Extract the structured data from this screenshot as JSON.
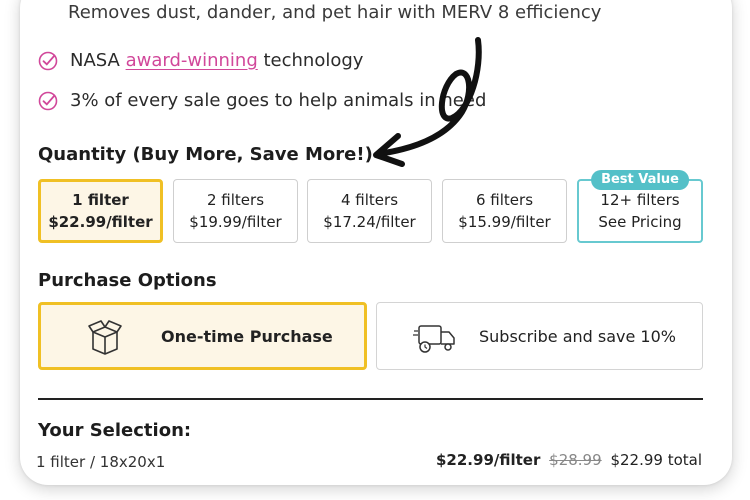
{
  "features": {
    "top_line": "Removes dust, dander, and pet hair with MERV 8 efficiency",
    "bullet1_prefix": "NASA",
    "bullet1_link": "award-winning",
    "bullet1_suffix": "technology",
    "bullet2": "3% of every sale goes to help animals in need"
  },
  "quantity": {
    "title": "Quantity (Buy More, Save More!)",
    "options": [
      {
        "line1": "1 filter",
        "line2": "$22.99/filter",
        "selected": true
      },
      {
        "line1": "2 filters",
        "line2": "$19.99/filter"
      },
      {
        "line1": "4 filters",
        "line2": "$17.24/filter"
      },
      {
        "line1": "6 filters",
        "line2": "$15.99/filter"
      },
      {
        "line1": "12+ filters",
        "line2": "See Pricing",
        "badge": "Best Value"
      }
    ]
  },
  "purchase": {
    "title": "Purchase Options",
    "one_time": "One-time Purchase",
    "subscribe": "Subscribe and save 10%"
  },
  "selection": {
    "title": "Your Selection:",
    "detail": "1 filter / 18x20x1",
    "unit_price": "$22.99/filter",
    "old_total": "$28.99",
    "new_total": "$22.99 total"
  },
  "colors": {
    "accent_yellow": "#f0c024",
    "selected_bg": "#fdf6e6",
    "badge_teal": "#54c0c8",
    "link_pink": "#d1479a"
  }
}
